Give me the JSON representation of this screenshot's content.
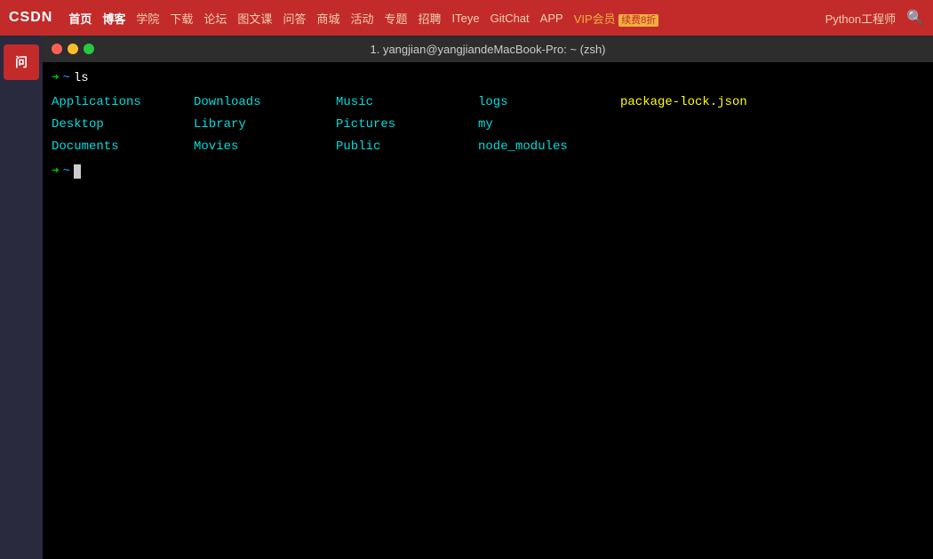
{
  "nav": {
    "logo": "CSDN",
    "items": [
      {
        "label": "首页",
        "active": false
      },
      {
        "label": "博客",
        "active": true
      },
      {
        "label": "学院",
        "active": false
      },
      {
        "label": "下载",
        "active": false
      },
      {
        "label": "论坛",
        "active": false
      },
      {
        "label": "图文课",
        "active": false
      },
      {
        "label": "问答",
        "active": false
      },
      {
        "label": "商城",
        "active": false
      },
      {
        "label": "活动",
        "active": false
      },
      {
        "label": "专题",
        "active": false
      },
      {
        "label": "招聘",
        "active": false
      },
      {
        "label": "ITeye",
        "active": false
      },
      {
        "label": "GitChat",
        "active": false
      },
      {
        "label": "APP",
        "active": false
      }
    ],
    "vip": "VIP会员",
    "vip_discount": "续费8折",
    "python": "Python工程师"
  },
  "terminal": {
    "title": "1. yangjian@yangjiandeMacBook-Pro: ~ (zsh)",
    "traffic_lights": [
      "red",
      "yellow",
      "green"
    ],
    "ls_command": "ls",
    "prompt_symbol": "→",
    "tilde": "~",
    "directories": [
      {
        "name": "Applications",
        "col": 0,
        "row": 0,
        "color": "cyan"
      },
      {
        "name": "Downloads",
        "col": 1,
        "row": 0,
        "color": "cyan"
      },
      {
        "name": "Music",
        "col": 2,
        "row": 0,
        "color": "cyan"
      },
      {
        "name": "logs",
        "col": 3,
        "row": 0,
        "color": "cyan"
      },
      {
        "name": "package-lock.json",
        "col": 4,
        "row": 0,
        "color": "yellow"
      },
      {
        "name": "Desktop",
        "col": 0,
        "row": 1,
        "color": "cyan"
      },
      {
        "name": "Library",
        "col": 1,
        "row": 1,
        "color": "cyan"
      },
      {
        "name": "Pictures",
        "col": 2,
        "row": 1,
        "color": "cyan"
      },
      {
        "name": "my",
        "col": 3,
        "row": 1,
        "color": "cyan"
      },
      {
        "name": "Documents",
        "col": 0,
        "row": 2,
        "color": "cyan"
      },
      {
        "name": "Movies",
        "col": 1,
        "row": 2,
        "color": "cyan"
      },
      {
        "name": "Public",
        "col": 2,
        "row": 2,
        "color": "cyan"
      },
      {
        "name": "node_modules",
        "col": 3,
        "row": 2,
        "color": "cyan"
      }
    ]
  },
  "sidebar": {
    "icon_label": "问"
  }
}
